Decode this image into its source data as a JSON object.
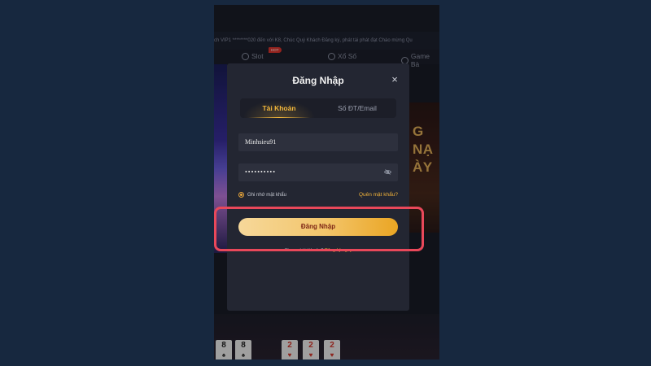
{
  "marquee": {
    "text": "ch VIP1 ********020 đến với K8, Chúc Quý Khách Đăng ký, phát tài phát đạt Chào mừng Qu"
  },
  "nav": {
    "items": [
      {
        "label": "Slot"
      },
      {
        "label": "Xổ Số"
      },
      {
        "label": "Game Bà"
      }
    ],
    "hot_badge": "HOT"
  },
  "banner": {
    "line1": "G NẠ",
    "line2": "ÀY"
  },
  "cards": [
    "8",
    "8",
    "2",
    "2",
    "2"
  ],
  "modal": {
    "title": "Đăng Nhập",
    "close": "×",
    "tabs": [
      {
        "label": "Tài Khoản",
        "active": true
      },
      {
        "label": "Số ĐT/Email",
        "active": false
      }
    ],
    "username": {
      "value": "Minhsieu91"
    },
    "password": {
      "value": "••••••••••"
    },
    "remember_label": "Ghi nhớ mật khẩu",
    "forgot_label": "Quên mật khẩu?",
    "login_button": "Đăng Nhập",
    "register_text": "Chưa có tài khoản?",
    "register_link": "Đăng ký ngay"
  },
  "colors": {
    "accent": "#f2b73b",
    "highlight": "#e9485a",
    "background": "#17283f"
  }
}
